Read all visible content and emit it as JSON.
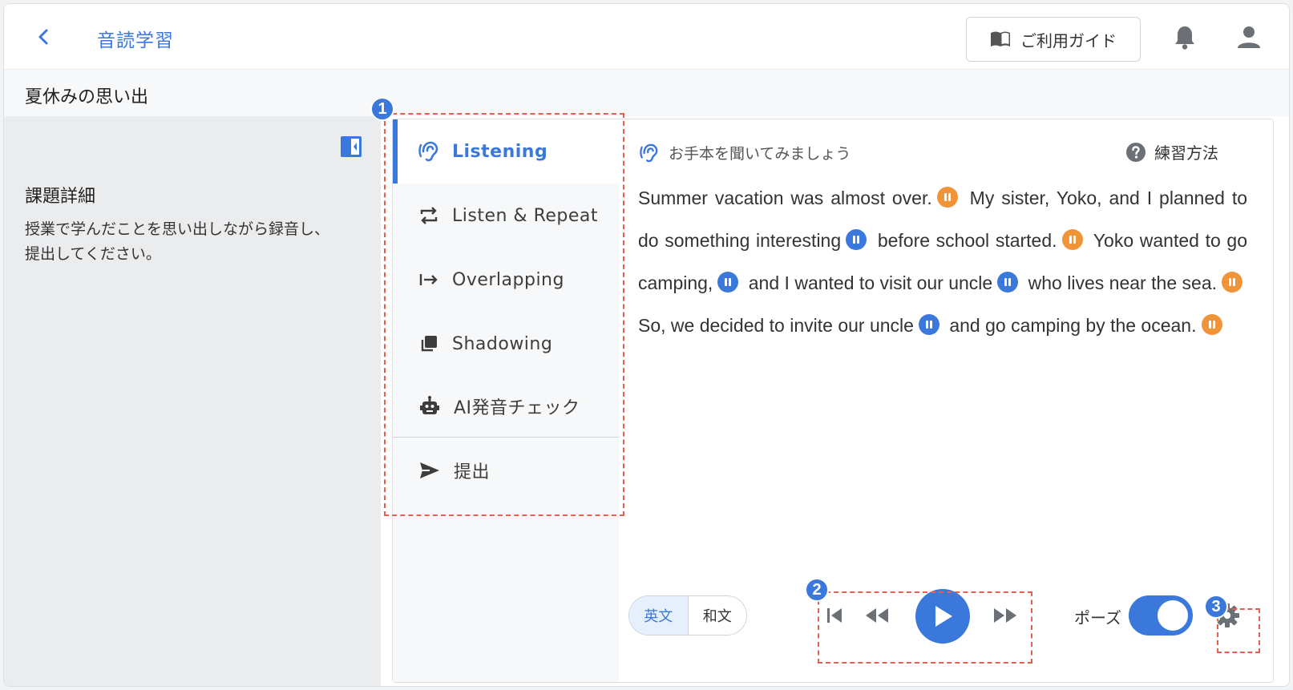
{
  "header": {
    "app_title": "音読学習",
    "guide_label": "ご利用ガイド"
  },
  "lesson": {
    "title": "夏休みの思い出"
  },
  "detail": {
    "title": "課題詳細",
    "text": "授業で学んだことを思い出しながら録音し、提出してください。"
  },
  "nav": {
    "items": [
      {
        "label": "Listening",
        "icon": "ear-icon",
        "active": true
      },
      {
        "label": "Listen & Repeat",
        "icon": "repeat-icon"
      },
      {
        "label": "Overlapping",
        "icon": "arrow-right-bar-icon"
      },
      {
        "label": "Shadowing",
        "icon": "copy-icon"
      },
      {
        "label": "AI発音チェック",
        "icon": "robot-icon"
      },
      {
        "label": "提出",
        "icon": "send-icon"
      }
    ]
  },
  "content": {
    "instruction": "お手本を聞いてみましょう",
    "help_label": "練習方法",
    "passage": [
      {
        "text": "Summer vacation was almost over.",
        "pause": "orange"
      },
      {
        "text": "My sister, Yoko, and I planned to do something interesting",
        "pause": "blue"
      },
      {
        "text": "before school started.",
        "pause": "orange"
      },
      {
        "text": "Yoko wanted to go camping,",
        "pause": "blue"
      },
      {
        "text": "and I wanted to visit our uncle",
        "pause": "blue"
      },
      {
        "text": "who lives near the sea.",
        "pause": "orange"
      },
      {
        "text": "So, we decided to invite our uncle",
        "pause": "blue"
      },
      {
        "text": "and go camping by the ocean.",
        "pause": "orange"
      }
    ]
  },
  "controls": {
    "lang_en": "英文",
    "lang_ja": "和文",
    "pause_label": "ポーズ",
    "pause_enabled": true
  },
  "annotations": {
    "badge1": "1",
    "badge2": "2",
    "badge3": "3"
  },
  "colors": {
    "accent": "#3b78dc",
    "pause_orange": "#f0943a",
    "annotation": "#e35f4f"
  }
}
